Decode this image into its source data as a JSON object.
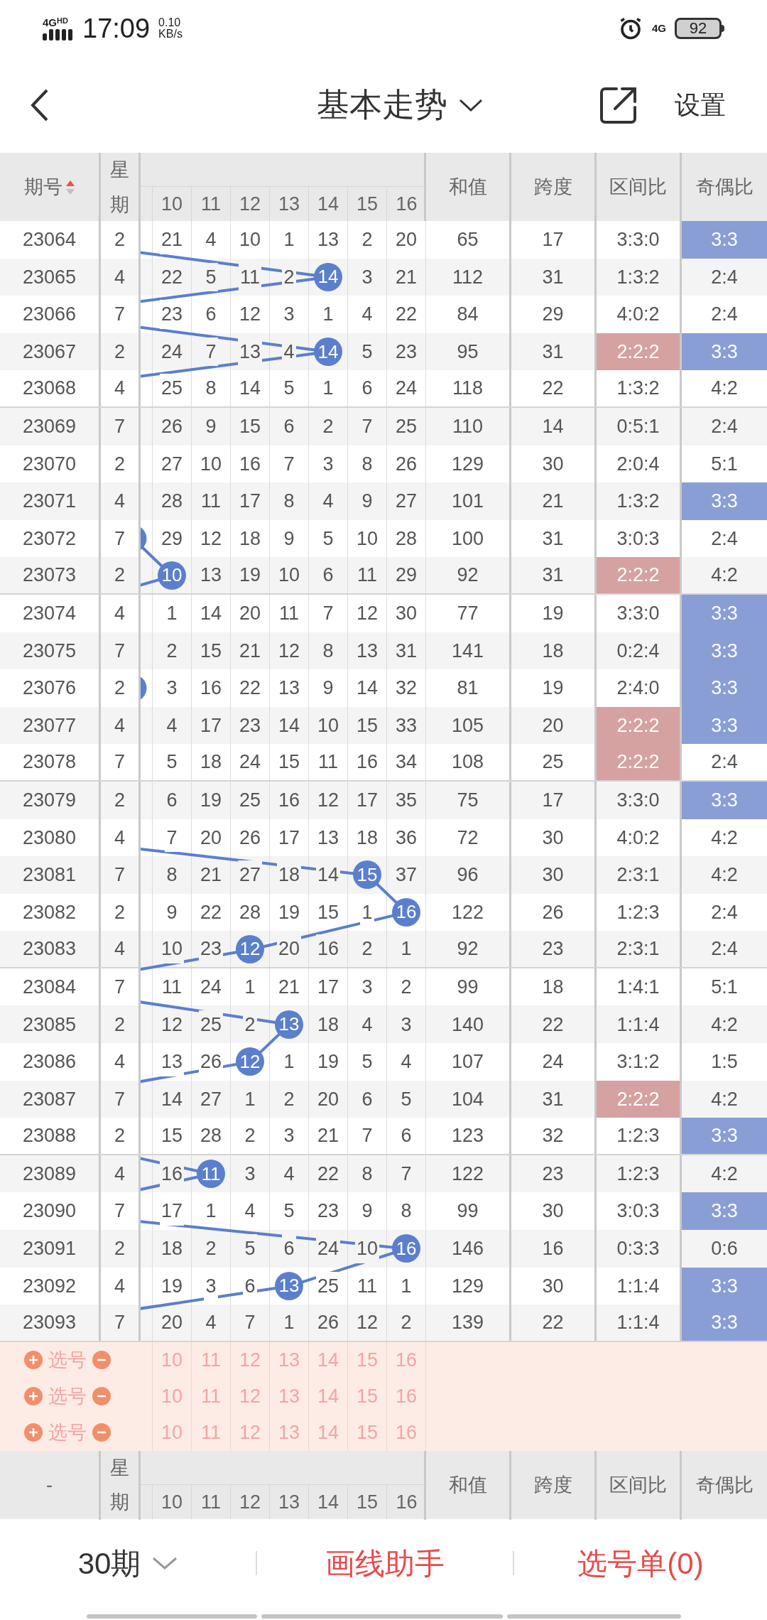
{
  "status_bar": {
    "network": "4G",
    "network_badge": "HD",
    "time": "17:09",
    "speed_value": "0.10",
    "speed_unit": "KB/s",
    "cellular": "4G",
    "battery": "92"
  },
  "nav": {
    "title": "基本走势",
    "settings": "设置"
  },
  "table": {
    "columns": {
      "issue": "期号",
      "week": "星期",
      "numbers": [
        "10",
        "11",
        "12",
        "13",
        "14",
        "15",
        "16"
      ],
      "sum": "和值",
      "span": "跨度",
      "zone_ratio": "区间比",
      "parity_ratio": "奇偶比"
    },
    "rows": [
      {
        "issue": "23064",
        "week": "2",
        "numbers": [
          "21",
          "4",
          "10",
          "1",
          "13",
          "2",
          "20"
        ],
        "circled": [
          false,
          false,
          false,
          false,
          false,
          false,
          false
        ],
        "edge_ball": false,
        "sum": "65",
        "span": "17",
        "zone_ratio": "3:3:0",
        "zone_highlight": false,
        "parity_ratio": "3:3",
        "parity_highlight": true
      },
      {
        "issue": "23065",
        "week": "4",
        "numbers": [
          "22",
          "5",
          "11",
          "2",
          "14",
          "3",
          "21"
        ],
        "circled": [
          false,
          false,
          false,
          false,
          true,
          false,
          false
        ],
        "edge_ball": false,
        "sum": "112",
        "span": "31",
        "zone_ratio": "1:3:2",
        "zone_highlight": false,
        "parity_ratio": "2:4",
        "parity_highlight": false
      },
      {
        "issue": "23066",
        "week": "7",
        "numbers": [
          "23",
          "6",
          "12",
          "3",
          "1",
          "4",
          "22"
        ],
        "circled": [
          false,
          false,
          false,
          false,
          false,
          false,
          false
        ],
        "edge_ball": false,
        "sum": "84",
        "span": "29",
        "zone_ratio": "4:0:2",
        "zone_highlight": false,
        "parity_ratio": "2:4",
        "parity_highlight": false
      },
      {
        "issue": "23067",
        "week": "2",
        "numbers": [
          "24",
          "7",
          "13",
          "4",
          "14",
          "5",
          "23"
        ],
        "circled": [
          false,
          false,
          false,
          false,
          true,
          false,
          false
        ],
        "edge_ball": false,
        "sum": "95",
        "span": "31",
        "zone_ratio": "2:2:2",
        "zone_highlight": true,
        "parity_ratio": "3:3",
        "parity_highlight": true
      },
      {
        "issue": "23068",
        "week": "4",
        "numbers": [
          "25",
          "8",
          "14",
          "5",
          "1",
          "6",
          "24"
        ],
        "circled": [
          false,
          false,
          false,
          false,
          false,
          false,
          false
        ],
        "edge_ball": false,
        "sum": "118",
        "span": "22",
        "zone_ratio": "1:3:2",
        "zone_highlight": false,
        "parity_ratio": "4:2",
        "parity_highlight": false
      },
      {
        "issue": "23069",
        "week": "7",
        "numbers": [
          "26",
          "9",
          "15",
          "6",
          "2",
          "7",
          "25"
        ],
        "circled": [
          false,
          false,
          false,
          false,
          false,
          false,
          false
        ],
        "edge_ball": false,
        "sum": "110",
        "span": "14",
        "zone_ratio": "0:5:1",
        "zone_highlight": false,
        "parity_ratio": "2:4",
        "parity_highlight": false
      },
      {
        "issue": "23070",
        "week": "2",
        "numbers": [
          "27",
          "10",
          "16",
          "7",
          "3",
          "8",
          "26"
        ],
        "circled": [
          false,
          false,
          false,
          false,
          false,
          false,
          false
        ],
        "edge_ball": false,
        "sum": "129",
        "span": "30",
        "zone_ratio": "2:0:4",
        "zone_highlight": false,
        "parity_ratio": "5:1",
        "parity_highlight": false
      },
      {
        "issue": "23071",
        "week": "4",
        "numbers": [
          "28",
          "11",
          "17",
          "8",
          "4",
          "9",
          "27"
        ],
        "circled": [
          false,
          false,
          false,
          false,
          false,
          false,
          false
        ],
        "edge_ball": false,
        "sum": "101",
        "span": "21",
        "zone_ratio": "1:3:2",
        "zone_highlight": false,
        "parity_ratio": "3:3",
        "parity_highlight": true
      },
      {
        "issue": "23072",
        "week": "7",
        "numbers": [
          "29",
          "12",
          "18",
          "9",
          "5",
          "10",
          "28"
        ],
        "circled": [
          false,
          false,
          false,
          false,
          false,
          false,
          false
        ],
        "edge_ball": true,
        "sum": "100",
        "span": "31",
        "zone_ratio": "3:0:3",
        "zone_highlight": false,
        "parity_ratio": "2:4",
        "parity_highlight": false
      },
      {
        "issue": "23073",
        "week": "2",
        "numbers": [
          "10",
          "13",
          "19",
          "10",
          "6",
          "11",
          "29"
        ],
        "circled": [
          true,
          false,
          false,
          false,
          false,
          false,
          false
        ],
        "edge_ball": false,
        "sum": "92",
        "span": "31",
        "zone_ratio": "2:2:2",
        "zone_highlight": true,
        "parity_ratio": "4:2",
        "parity_highlight": false
      },
      {
        "issue": "23074",
        "week": "4",
        "numbers": [
          "1",
          "14",
          "20",
          "11",
          "7",
          "12",
          "30"
        ],
        "circled": [
          false,
          false,
          false,
          false,
          false,
          false,
          false
        ],
        "edge_ball": false,
        "sum": "77",
        "span": "19",
        "zone_ratio": "3:3:0",
        "zone_highlight": false,
        "parity_ratio": "3:3",
        "parity_highlight": true
      },
      {
        "issue": "23075",
        "week": "7",
        "numbers": [
          "2",
          "15",
          "21",
          "12",
          "8",
          "13",
          "31"
        ],
        "circled": [
          false,
          false,
          false,
          false,
          false,
          false,
          false
        ],
        "edge_ball": false,
        "sum": "141",
        "span": "18",
        "zone_ratio": "0:2:4",
        "zone_highlight": false,
        "parity_ratio": "3:3",
        "parity_highlight": true
      },
      {
        "issue": "23076",
        "week": "2",
        "numbers": [
          "3",
          "16",
          "22",
          "13",
          "9",
          "14",
          "32"
        ],
        "circled": [
          false,
          false,
          false,
          false,
          false,
          false,
          false
        ],
        "edge_ball": true,
        "sum": "81",
        "span": "19",
        "zone_ratio": "2:4:0",
        "zone_highlight": false,
        "parity_ratio": "3:3",
        "parity_highlight": true
      },
      {
        "issue": "23077",
        "week": "4",
        "numbers": [
          "4",
          "17",
          "23",
          "14",
          "10",
          "15",
          "33"
        ],
        "circled": [
          false,
          false,
          false,
          false,
          false,
          false,
          false
        ],
        "edge_ball": false,
        "sum": "105",
        "span": "20",
        "zone_ratio": "2:2:2",
        "zone_highlight": true,
        "parity_ratio": "3:3",
        "parity_highlight": true
      },
      {
        "issue": "23078",
        "week": "7",
        "numbers": [
          "5",
          "18",
          "24",
          "15",
          "11",
          "16",
          "34"
        ],
        "circled": [
          false,
          false,
          false,
          false,
          false,
          false,
          false
        ],
        "edge_ball": false,
        "sum": "108",
        "span": "25",
        "zone_ratio": "2:2:2",
        "zone_highlight": true,
        "parity_ratio": "2:4",
        "parity_highlight": false
      },
      {
        "issue": "23079",
        "week": "2",
        "numbers": [
          "6",
          "19",
          "25",
          "16",
          "12",
          "17",
          "35"
        ],
        "circled": [
          false,
          false,
          false,
          false,
          false,
          false,
          false
        ],
        "edge_ball": false,
        "sum": "75",
        "span": "17",
        "zone_ratio": "3:3:0",
        "zone_highlight": false,
        "parity_ratio": "3:3",
        "parity_highlight": true
      },
      {
        "issue": "23080",
        "week": "4",
        "numbers": [
          "7",
          "20",
          "26",
          "17",
          "13",
          "18",
          "36"
        ],
        "circled": [
          false,
          false,
          false,
          false,
          false,
          false,
          false
        ],
        "edge_ball": false,
        "sum": "72",
        "span": "30",
        "zone_ratio": "4:0:2",
        "zone_highlight": false,
        "parity_ratio": "4:2",
        "parity_highlight": false
      },
      {
        "issue": "23081",
        "week": "7",
        "numbers": [
          "8",
          "21",
          "27",
          "18",
          "14",
          "15",
          "37"
        ],
        "circled": [
          false,
          false,
          false,
          false,
          false,
          true,
          false
        ],
        "edge_ball": false,
        "sum": "96",
        "span": "30",
        "zone_ratio": "2:3:1",
        "zone_highlight": false,
        "parity_ratio": "4:2",
        "parity_highlight": false
      },
      {
        "issue": "23082",
        "week": "2",
        "numbers": [
          "9",
          "22",
          "28",
          "19",
          "15",
          "1",
          "16"
        ],
        "circled": [
          false,
          false,
          false,
          false,
          false,
          false,
          true
        ],
        "edge_ball": false,
        "sum": "122",
        "span": "26",
        "zone_ratio": "1:2:3",
        "zone_highlight": false,
        "parity_ratio": "2:4",
        "parity_highlight": false
      },
      {
        "issue": "23083",
        "week": "4",
        "numbers": [
          "10",
          "23",
          "12",
          "20",
          "16",
          "2",
          "1"
        ],
        "circled": [
          false,
          false,
          true,
          false,
          false,
          false,
          false
        ],
        "edge_ball": false,
        "sum": "92",
        "span": "23",
        "zone_ratio": "2:3:1",
        "zone_highlight": false,
        "parity_ratio": "2:4",
        "parity_highlight": false
      },
      {
        "issue": "23084",
        "week": "7",
        "numbers": [
          "11",
          "24",
          "1",
          "21",
          "17",
          "3",
          "2"
        ],
        "circled": [
          false,
          false,
          false,
          false,
          false,
          false,
          false
        ],
        "edge_ball": false,
        "sum": "99",
        "span": "18",
        "zone_ratio": "1:4:1",
        "zone_highlight": false,
        "parity_ratio": "5:1",
        "parity_highlight": false
      },
      {
        "issue": "23085",
        "week": "2",
        "numbers": [
          "12",
          "25",
          "2",
          "13",
          "18",
          "4",
          "3"
        ],
        "circled": [
          false,
          false,
          false,
          true,
          false,
          false,
          false
        ],
        "edge_ball": false,
        "sum": "140",
        "span": "22",
        "zone_ratio": "1:1:4",
        "zone_highlight": false,
        "parity_ratio": "4:2",
        "parity_highlight": false
      },
      {
        "issue": "23086",
        "week": "4",
        "numbers": [
          "13",
          "26",
          "12",
          "1",
          "19",
          "5",
          "4"
        ],
        "circled": [
          false,
          false,
          true,
          false,
          false,
          false,
          false
        ],
        "edge_ball": false,
        "sum": "107",
        "span": "24",
        "zone_ratio": "3:1:2",
        "zone_highlight": false,
        "parity_ratio": "1:5",
        "parity_highlight": false
      },
      {
        "issue": "23087",
        "week": "7",
        "numbers": [
          "14",
          "27",
          "1",
          "2",
          "20",
          "6",
          "5"
        ],
        "circled": [
          false,
          false,
          false,
          false,
          false,
          false,
          false
        ],
        "edge_ball": false,
        "sum": "104",
        "span": "31",
        "zone_ratio": "2:2:2",
        "zone_highlight": true,
        "parity_ratio": "4:2",
        "parity_highlight": false
      },
      {
        "issue": "23088",
        "week": "2",
        "numbers": [
          "15",
          "28",
          "2",
          "3",
          "21",
          "7",
          "6"
        ],
        "circled": [
          false,
          false,
          false,
          false,
          false,
          false,
          false
        ],
        "edge_ball": false,
        "sum": "123",
        "span": "32",
        "zone_ratio": "1:2:3",
        "zone_highlight": false,
        "parity_ratio": "3:3",
        "parity_highlight": true
      },
      {
        "issue": "23089",
        "week": "4",
        "numbers": [
          "16",
          "11",
          "3",
          "4",
          "22",
          "8",
          "7"
        ],
        "circled": [
          false,
          true,
          false,
          false,
          false,
          false,
          false
        ],
        "edge_ball": false,
        "sum": "122",
        "span": "23",
        "zone_ratio": "1:2:3",
        "zone_highlight": false,
        "parity_ratio": "4:2",
        "parity_highlight": false
      },
      {
        "issue": "23090",
        "week": "7",
        "numbers": [
          "17",
          "1",
          "4",
          "5",
          "23",
          "9",
          "8"
        ],
        "circled": [
          false,
          false,
          false,
          false,
          false,
          false,
          false
        ],
        "edge_ball": false,
        "sum": "99",
        "span": "30",
        "zone_ratio": "3:0:3",
        "zone_highlight": false,
        "parity_ratio": "3:3",
        "parity_highlight": true
      },
      {
        "issue": "23091",
        "week": "2",
        "numbers": [
          "18",
          "2",
          "5",
          "6",
          "24",
          "10",
          "16"
        ],
        "circled": [
          false,
          false,
          false,
          false,
          false,
          false,
          true
        ],
        "edge_ball": false,
        "sum": "146",
        "span": "16",
        "zone_ratio": "0:3:3",
        "zone_highlight": false,
        "parity_ratio": "0:6",
        "parity_highlight": false
      },
      {
        "issue": "23092",
        "week": "4",
        "numbers": [
          "19",
          "3",
          "6",
          "13",
          "25",
          "11",
          "1"
        ],
        "circled": [
          false,
          false,
          false,
          true,
          false,
          false,
          false
        ],
        "edge_ball": false,
        "sum": "129",
        "span": "30",
        "zone_ratio": "1:1:4",
        "zone_highlight": false,
        "parity_ratio": "3:3",
        "parity_highlight": true
      },
      {
        "issue": "23093",
        "week": "7",
        "numbers": [
          "20",
          "4",
          "7",
          "1",
          "26",
          "12",
          "2"
        ],
        "circled": [
          false,
          false,
          false,
          false,
          false,
          false,
          false
        ],
        "edge_ball": false,
        "sum": "139",
        "span": "22",
        "zone_ratio": "1:1:4",
        "zone_highlight": false,
        "parity_ratio": "3:3",
        "parity_highlight": true
      }
    ],
    "pick_rows": [
      {
        "label": "选号",
        "numbers": [
          "10",
          "11",
          "12",
          "13",
          "14",
          "15",
          "16"
        ]
      },
      {
        "label": "选号",
        "numbers": [
          "10",
          "11",
          "12",
          "13",
          "14",
          "15",
          "16"
        ]
      },
      {
        "label": "选号",
        "numbers": [
          "10",
          "11",
          "12",
          "13",
          "14",
          "15",
          "16"
        ]
      }
    ],
    "footer_header": {
      "issue": "-",
      "week": "星期",
      "numbers": [
        "10",
        "11",
        "12",
        "13",
        "14",
        "15",
        "16"
      ],
      "sum": "和值",
      "span": "跨度",
      "zone_ratio": "区间比",
      "parity_ratio": "奇偶比"
    }
  },
  "bottom_bar": {
    "periods": "30期",
    "draw_helper": "画线助手",
    "pick_list": "选号单(0)"
  }
}
